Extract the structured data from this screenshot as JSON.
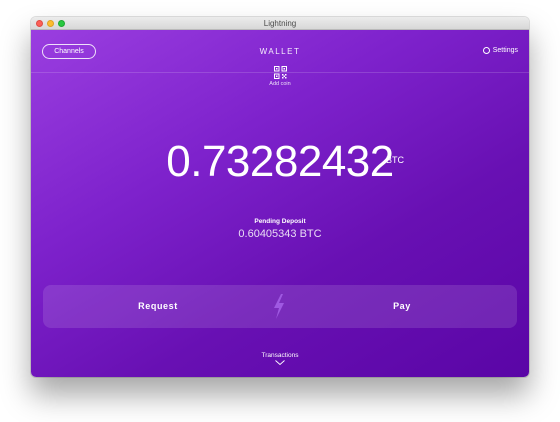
{
  "window": {
    "title": "Lightning"
  },
  "header": {
    "channels_label": "Channels",
    "title": "WALLET",
    "settings_label": "Settings"
  },
  "add_coin": {
    "icon": "qr-code-icon",
    "label": "Add coin"
  },
  "balance": {
    "value": "0.73282432",
    "unit": "BTC"
  },
  "pending": {
    "label": "Pending Deposit",
    "value": "0.60405343 BTC"
  },
  "actions": {
    "request_label": "Request",
    "pay_label": "Pay",
    "divider_icon": "lightning-bolt-icon"
  },
  "transactions": {
    "label": "Transactions",
    "icon": "chevron-down-icon"
  },
  "colors": {
    "background_start": "#9a3ee0",
    "background_end": "#5a05a6",
    "text": "#ffffff"
  }
}
